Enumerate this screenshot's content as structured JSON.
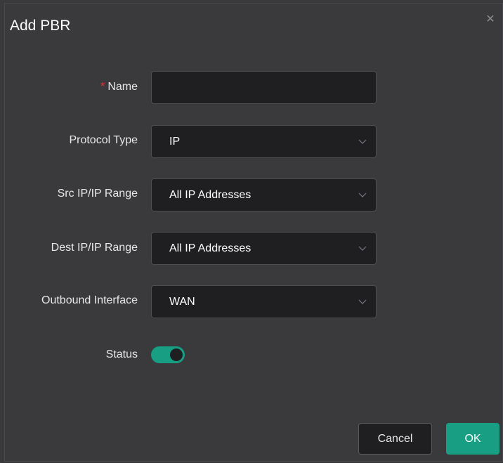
{
  "dialog": {
    "title": "Add PBR",
    "close_icon": "close-icon"
  },
  "form": {
    "name": {
      "required_mark": "*",
      "label": "Name",
      "value": ""
    },
    "protocol_type": {
      "label": "Protocol Type",
      "value": "IP"
    },
    "src_ip": {
      "label": "Src IP/IP Range",
      "value": "All IP Addresses"
    },
    "dest_ip": {
      "label": "Dest IP/IP Range",
      "value": "All IP Addresses"
    },
    "outbound_interface": {
      "label": "Outbound Interface",
      "value": "WAN"
    },
    "status": {
      "label": "Status",
      "enabled": true
    }
  },
  "buttons": {
    "cancel": "Cancel",
    "ok": "OK"
  },
  "colors": {
    "accent": "#179e83",
    "required": "#e03c3c",
    "background": "#3a3a3d",
    "field": "#1f1f21"
  }
}
